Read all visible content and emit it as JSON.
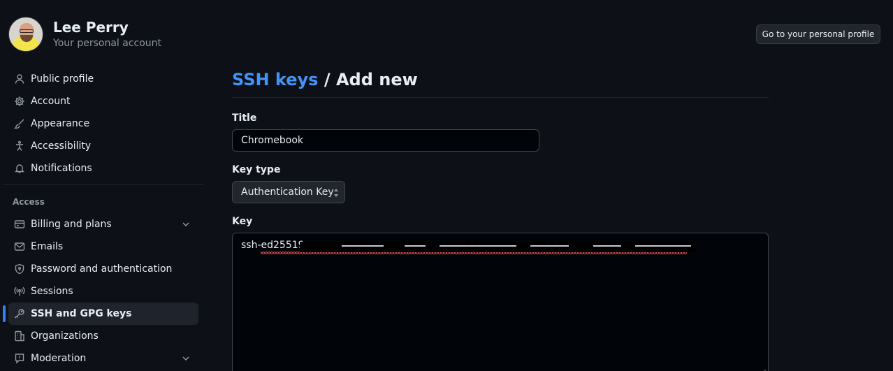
{
  "header": {
    "user_name": "Lee Perry",
    "user_subtitle": "Your personal account",
    "profile_button": "Go to your personal profile"
  },
  "sidebar": {
    "items": [
      {
        "label": "Public profile",
        "icon": "person-icon"
      },
      {
        "label": "Account",
        "icon": "gear-icon"
      },
      {
        "label": "Appearance",
        "icon": "paintbrush-icon"
      },
      {
        "label": "Accessibility",
        "icon": "accessibility-icon"
      },
      {
        "label": "Notifications",
        "icon": "bell-icon"
      }
    ],
    "access_heading": "Access",
    "access_items": [
      {
        "label": "Billing and plans",
        "icon": "credit-card-icon",
        "expandable": true
      },
      {
        "label": "Emails",
        "icon": "mail-icon"
      },
      {
        "label": "Password and authentication",
        "icon": "shield-lock-icon"
      },
      {
        "label": "Sessions",
        "icon": "broadcast-icon"
      },
      {
        "label": "SSH and GPG keys",
        "icon": "key-icon",
        "active": true
      },
      {
        "label": "Organizations",
        "icon": "organization-icon"
      },
      {
        "label": "Moderation",
        "icon": "report-icon",
        "expandable": true
      }
    ]
  },
  "main": {
    "breadcrumb_link": "SSH keys",
    "breadcrumb_separator": " / ",
    "page_title": "Add new",
    "title_label": "Title",
    "title_value": "Chromebook",
    "key_type_label": "Key type",
    "key_type_value": "Authentication Key",
    "key_label": "Key",
    "key_value_visible": "ssh-ed25519"
  },
  "colors": {
    "background": "#0d1117",
    "accent": "#2f81f7",
    "link": "#4493f8",
    "muted_text": "#8d96a0"
  }
}
